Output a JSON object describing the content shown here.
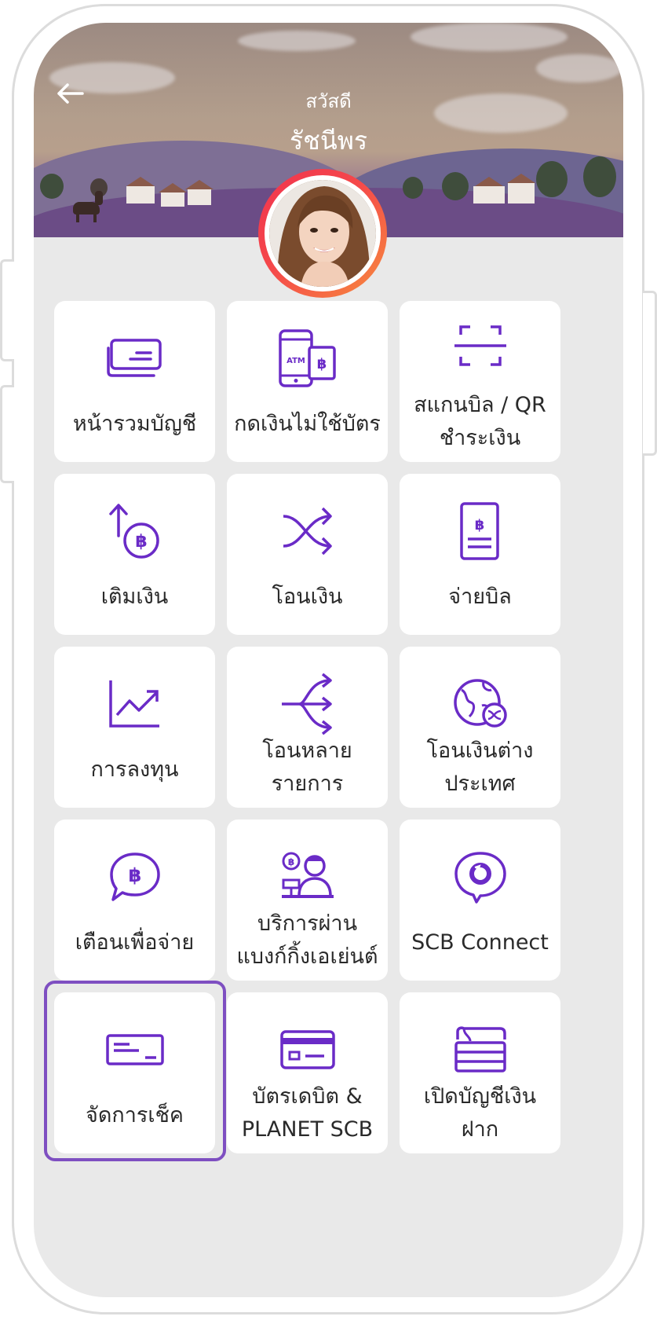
{
  "header": {
    "greeting": "สวัสดี",
    "name": "รัชนีพร"
  },
  "accent_color": "#6a2bc7",
  "highlight_color": "#7e4fc1",
  "menu": [
    {
      "label": "หน้ารวมบัญชี",
      "icon": "cards-icon"
    },
    {
      "label": "กดเงินไม่ใช้บัตร",
      "icon": "atm-phone-icon",
      "icon_text_atm": "ATM",
      "icon_text_baht": "฿"
    },
    {
      "label_line1": "สแกนบิล / QR",
      "label_line2": "ชำระเงิน",
      "icon": "scan-icon"
    },
    {
      "label": "เติมเงิน",
      "icon": "top-up-icon",
      "icon_text_baht": "฿"
    },
    {
      "label": "โอนเงิน",
      "icon": "transfer-icon"
    },
    {
      "label": "จ่ายบิล",
      "icon": "bill-icon",
      "icon_text_baht": "฿"
    },
    {
      "label": "การลงทุน",
      "icon": "investment-chart-icon"
    },
    {
      "label_line1": "โอนหลาย",
      "label_line2": "รายการ",
      "icon": "multi-transfer-icon"
    },
    {
      "label_line1": "โอนเงินต่าง",
      "label_line2": "ประเทศ",
      "icon": "globe-transfer-icon"
    },
    {
      "label": "เตือนเพื่อจ่าย",
      "icon": "payment-reminder-icon",
      "icon_text_baht": "฿"
    },
    {
      "label_line1": "บริการผ่าน",
      "label_line2": "แบงก์กิ้งเอเย่นต์",
      "icon": "banking-agent-icon",
      "icon_text_baht": "฿"
    },
    {
      "label": "SCB Connect",
      "icon": "scb-connect-icon"
    },
    {
      "label": "จัดการเช็ค",
      "icon": "cheque-icon"
    },
    {
      "label_line1": "บัตรเดบิต &",
      "label_line2": "PLANET SCB",
      "icon": "debit-card-icon"
    },
    {
      "label_line1": "เปิดบัญชีเงิน",
      "label_line2": "ฝาก",
      "icon": "open-account-icon"
    }
  ]
}
